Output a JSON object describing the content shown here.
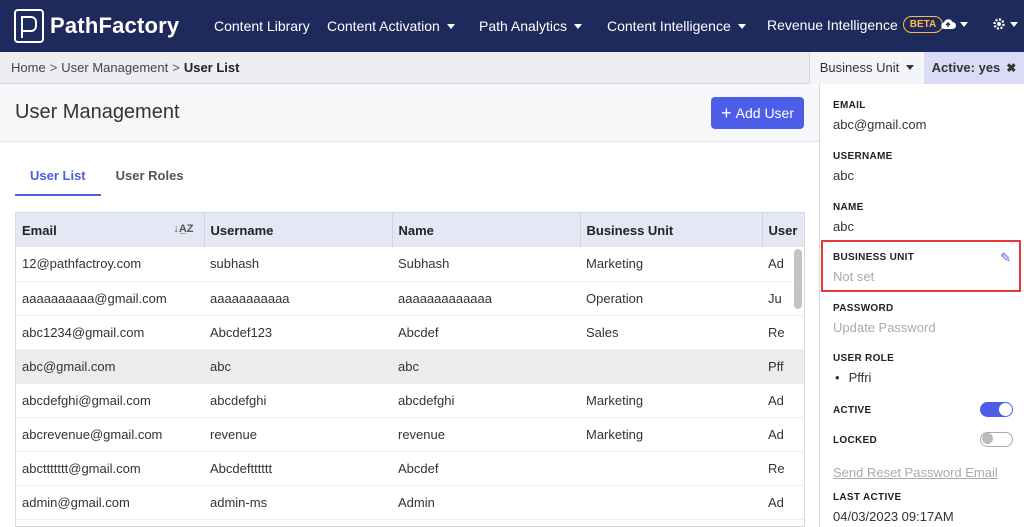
{
  "header": {
    "logo_text": "PathFactory",
    "nav": [
      {
        "label": "Content Library",
        "dropdown": false
      },
      {
        "label": "Content Activation",
        "dropdown": true
      },
      {
        "label": "Path Analytics",
        "dropdown": true
      },
      {
        "label": "Content Intelligence",
        "dropdown": true
      },
      {
        "label": "Revenue Intelligence",
        "dropdown": false
      }
    ],
    "beta_badge": "BETA",
    "icons": [
      "cloud-icon",
      "gear-icon"
    ]
  },
  "breadcrumb": {
    "items": [
      "Home",
      "User Management"
    ],
    "current": "User List",
    "separator": ">"
  },
  "filters": {
    "business_unit_label": "Business Unit",
    "active_label": "Active: yes",
    "clear_icon": "✖"
  },
  "main": {
    "title": "User Management",
    "add_button_label": "Add User",
    "tabs": [
      {
        "label": "User List",
        "active": true
      },
      {
        "label": "User Roles",
        "active": false
      }
    ]
  },
  "table": {
    "columns": [
      "Email",
      "Username",
      "Name",
      "Business Unit",
      "User"
    ],
    "rows": [
      [
        "12@pathfactroy.com",
        "subhash",
        "Subhash",
        "Marketing",
        "Ad"
      ],
      [
        "aaaaaaaaaa@gmail.com",
        "aaaaaaaaaaa",
        "aaaaaaaaaaaaa",
        "Operation",
        "Ju"
      ],
      [
        "abc1234@gmail.com",
        "Abcdef123",
        "Abcdef",
        "Sales",
        "Re"
      ],
      [
        "abc@gmail.com",
        "abc",
        "abc",
        "",
        "Pff"
      ],
      [
        "abcdefghi@gmail.com",
        "abcdefghi",
        "abcdefghi",
        "Marketing",
        "Ad"
      ],
      [
        "abcrevenue@gmail.com",
        "revenue",
        "revenue",
        "Marketing",
        "Ad"
      ],
      [
        "abcttttttt@gmail.com",
        "Abcdeftttttt",
        "Abcdef",
        "",
        "Re"
      ],
      [
        "admin@gmail.com",
        "admin-ms",
        "Admin",
        "",
        "Ad"
      ]
    ],
    "selected_row": 3
  },
  "details": {
    "email_label": "EMAIL",
    "email_value": "abc@gmail.com",
    "username_label": "USERNAME",
    "username_value": "abc",
    "name_label": "NAME",
    "name_value": "abc",
    "business_unit_label": "BUSINESS UNIT",
    "business_unit_value": "Not set",
    "password_label": "PASSWORD",
    "password_value": "Update Password",
    "user_role_label": "USER ROLE",
    "user_role_items": [
      "Pffri"
    ],
    "active_label": "ACTIVE",
    "active_on": true,
    "locked_label": "LOCKED",
    "locked_on": false,
    "reset_link": "Send Reset Password Email",
    "last_active_label": "LAST ACTIVE",
    "last_active_value": "04/03/2023 09:17AM"
  }
}
